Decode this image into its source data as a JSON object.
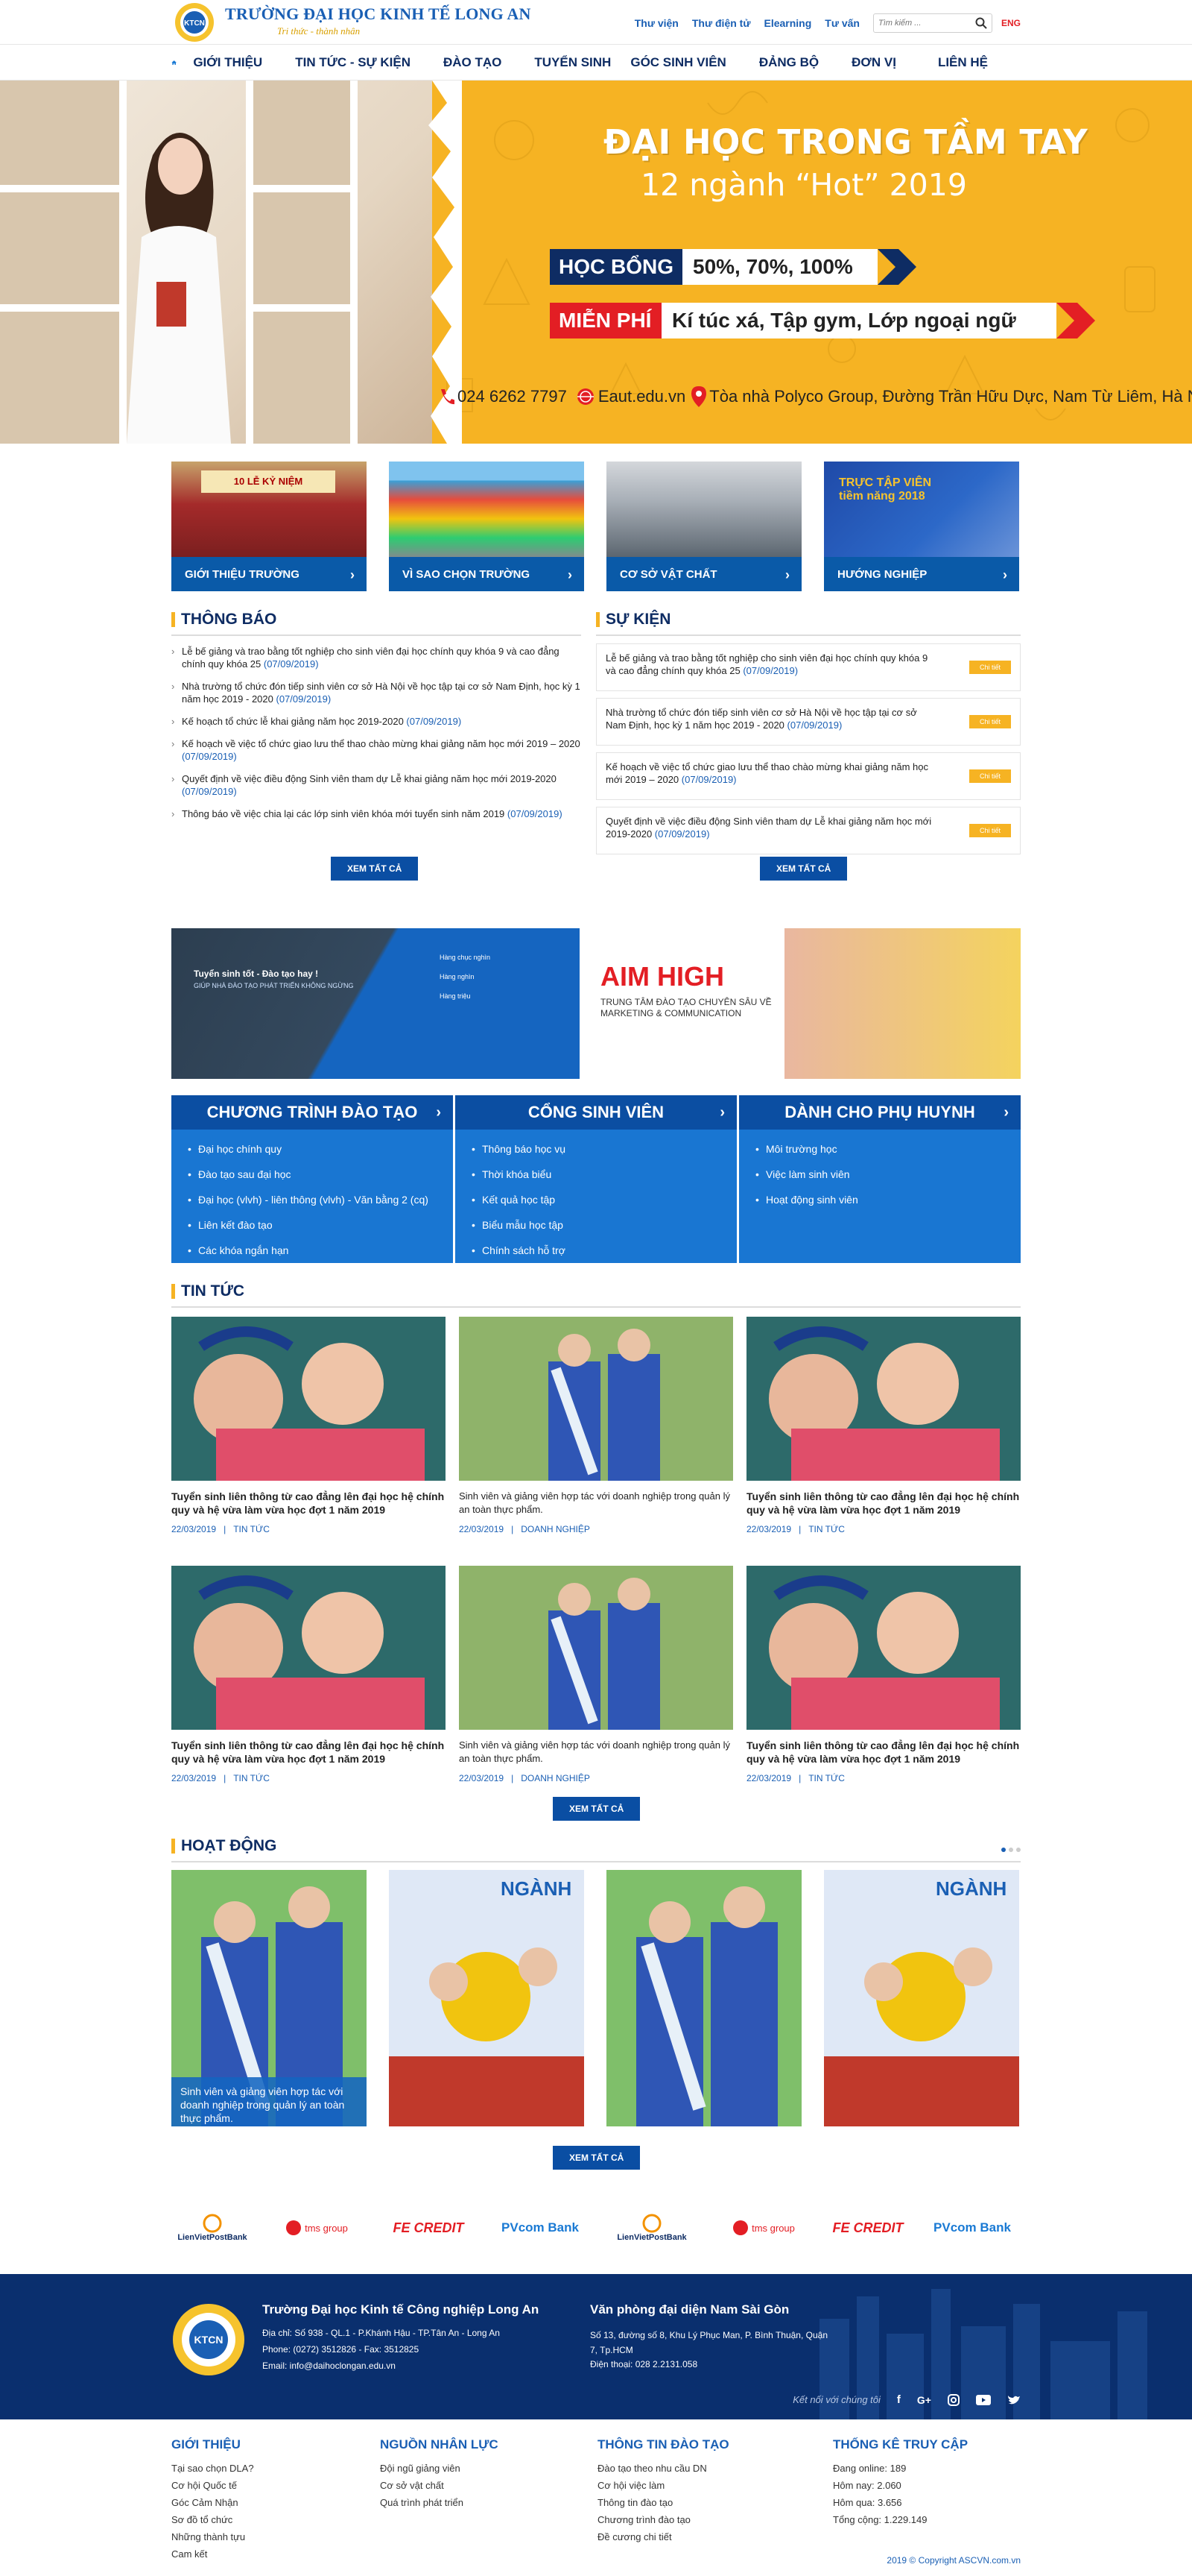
{
  "header": {
    "logo_text": "KTCN",
    "brand_title": "Trường Đại Học Kinh Tế Long An",
    "brand_slogan": "Tri thức - thành nhân",
    "top_links": [
      "Thư viện",
      "Thư điện tử",
      "Elearning",
      "Tư vấn"
    ],
    "search_placeholder": "Tìm kiếm ...",
    "lang": "ENG"
  },
  "nav": {
    "items": [
      "GIỚI THIỆU",
      "TIN TỨC - SỰ KIỆN",
      "ĐÀO TẠO",
      "TUYỂN SINH",
      "GÓC SINH VIÊN",
      "ĐẢNG BỘ",
      "ĐƠN VỊ",
      "LIÊN HỆ"
    ]
  },
  "hero": {
    "title": "ĐẠI HỌC TRONG TẦM TAY",
    "subtitle": "12 ngành “Hot” 2019",
    "scholarship_label": "HỌC BỔNG",
    "scholarship_value": "50%, 70%, 100%",
    "free_label": "MIỄN PHÍ",
    "free_value": "Kí túc xá, Tập gym, Lớp ngoại ngữ",
    "phone": "024 6262 7797",
    "web": "Eaut.edu.vn",
    "address": "Tòa nhà Polyco Group, Đường Trần Hữu Dực, Nam Từ Liêm, Hà Nội",
    "colors": {
      "yellow": "#f6b323",
      "navy": "#0e2c63",
      "red": "#e31e24"
    }
  },
  "tiles": [
    {
      "label": "GIỚI THIỆU TRƯỜNG",
      "image_sign": "10 LỄ KỶ NIỆM"
    },
    {
      "label": "VÌ SAO CHỌN TRƯỜNG"
    },
    {
      "label": "CƠ SỞ VẬT CHẤT"
    },
    {
      "label": "HƯỚNG NGHIỆP",
      "image_sign": "TRỰC TẬP VIÊN tiềm năng 2018"
    }
  ],
  "thong_bao": {
    "title": "THÔNG BÁO",
    "items": [
      {
        "text": "Lễ bế giảng và trao bằng tốt nghiệp cho sinh viên đại học chính quy khóa 9 và cao đẳng chính quy khóa 25",
        "date": "(07/09/2019)"
      },
      {
        "text": "Nhà trường tổ chức đón tiếp sinh viên cơ sở Hà Nội về học tập tại cơ sở Nam Định, học kỳ 1 năm học 2019 - 2020",
        "date": "(07/09/2019)"
      },
      {
        "text": "Kế hoạch tổ chức lễ khai giảng năm học 2019-2020",
        "date": "(07/09/2019)"
      },
      {
        "text": "Kế hoạch về việc tổ chức giao lưu thể thao chào mừng khai giảng năm học mới 2019 – 2020",
        "date": "(07/09/2019)"
      },
      {
        "text": "Quyết định về việc điều động Sinh viên tham dự Lễ khai giảng năm học mới 2019-2020",
        "date": "(07/09/2019)"
      },
      {
        "text": "Thông báo về việc chia lại các lớp sinh viên khóa mới tuyển sinh năm 2019",
        "date": "(07/09/2019)"
      }
    ],
    "view_all": "XEM TẤT CẢ"
  },
  "su_kien": {
    "title": "SỰ KIỆN",
    "detail_label": "Chi tiết",
    "items": [
      {
        "text": "Lễ bế giảng và trao bằng tốt nghiệp cho sinh viên đại học chính quy khóa 9 và cao đẳng chính quy khóa 25",
        "date": "(07/09/2019)"
      },
      {
        "text": "Nhà trường tổ chức đón tiếp sinh viên cơ sở Hà Nội về học tập tại cơ sở Nam Định, học kỳ 1 năm học 2019 - 2020",
        "date": "(07/09/2019)"
      },
      {
        "text": "Kế hoạch về việc tổ chức giao lưu thể thao chào mừng khai giảng năm học mới 2019 – 2020",
        "date": "(07/09/2019)"
      },
      {
        "text": "Quyết định về việc điều động Sinh viên tham dự Lễ khai giảng năm học mới 2019-2020",
        "date": "(07/09/2019)"
      }
    ],
    "view_all": "XEM TẤT CẢ"
  },
  "banners": {
    "left_title": "Tuyển sinh tốt - Đào tạo hay !",
    "left_sub": "GIÚP NHÀ ĐÀO TẠO PHÁT TRIỂN KHÔNG NGỪNG",
    "left_items": [
      "Hàng chục nghìn",
      "Hàng nghìn",
      "Hàng triệu"
    ],
    "right_title": "AIM HIGH",
    "right_sub": "TRUNG TÂM ĐÀO TẠO CHUYÊN SÂU VỀ MARKETING & COMMUNICATION"
  },
  "programs": [
    {
      "title": "CHƯƠNG TRÌNH ĐÀO TẠO",
      "items": [
        "Đại học chính quy",
        "Đào tạo sau đại học",
        "Đại học (vlvh) - liên thông (vlvh) - Văn bằng 2 (cq)",
        "Liên kết đào tạo",
        "Các khóa ngắn hạn"
      ]
    },
    {
      "title": "CỔNG SINH VIÊN",
      "items": [
        "Thông báo học vụ",
        "Thời khóa biểu",
        "Kết quả học tập",
        "Biểu mẫu học tập",
        "Chính sách hỗ trợ"
      ]
    },
    {
      "title": "DÀNH CHO PHỤ HUYNH",
      "items": [
        "Môi trường học",
        "Việc làm sinh viên",
        "Hoạt động sinh viên"
      ]
    }
  ],
  "tin_tuc": {
    "title": "TIN TỨC",
    "cards": [
      {
        "title": "Tuyển sinh liên thông từ cao đẳng lên đại học hệ chính quy và hệ vừa làm vừa học đợt 1 năm 2019",
        "date": "22/03/2019",
        "cat": "TIN TỨC",
        "img": "a"
      },
      {
        "title": "Sinh viên và giảng viên hợp tác với doanh nghiệp trong quản lý an toàn thực phẩm.",
        "date": "22/03/2019",
        "cat": "DOANH NGHIỆP",
        "img": "b"
      },
      {
        "title": "Tuyển sinh liên thông từ cao đẳng lên đại học hệ chính quy và hệ vừa làm vừa học đợt 1 năm 2019",
        "date": "22/03/2019",
        "cat": "TIN TỨC",
        "img": "a"
      },
      {
        "title": "Tuyển sinh liên thông từ cao đẳng lên đại học hệ chính quy và hệ vừa làm vừa học đợt 1 năm 2019",
        "date": "22/03/2019",
        "cat": "TIN TỨC",
        "img": "a"
      },
      {
        "title": "Sinh viên và giảng viên hợp tác với doanh nghiệp trong quản lý an toàn thực phẩm.",
        "date": "22/03/2019",
        "cat": "DOANH NGHIỆP",
        "img": "b"
      },
      {
        "title": "Tuyển sinh liên thông từ cao đẳng lên đại học hệ chính quy và hệ vừa làm vừa học đợt 1 năm 2019",
        "date": "22/03/2019",
        "cat": "TIN TỨC",
        "img": "a"
      }
    ],
    "view_all": "XEM TẤT CẢ"
  },
  "hoat_dong": {
    "title": "HOẠT ĐỘNG",
    "first_caption": "Sinh viên và giảng viên hợp tác với doanh nghiệp trong quản lý an toàn thực phẩm.",
    "image_sign": "NGÀNH",
    "view_all": "XEM TẤT CẢ"
  },
  "partners": [
    "LienVietPostBank",
    "tms group",
    "FE CREDIT",
    "PVcom Bank",
    "LienVietPostBank",
    "tms group",
    "FE CREDIT",
    "PVcom Bank"
  ],
  "footer": {
    "school_name": "Trường Đại học Kinh tế Công nghiệp Long An",
    "address": "Địa chỉ: Số 938 - QL.1 - P.Khánh Hậu - TP.Tân An - Long An",
    "phone": "Phone: (0272) 3512826 - Fax: 3512825",
    "email": "Email: info@daihoclongan.edu.vn",
    "office_title": "Văn phòng đại diện Nam Sài Gòn",
    "office_address": "Số 13, đường số 8, Khu Lý Phục Man, P. Bình Thuận, Quận 7, Tp.HCM",
    "office_phone": "Điện thoại: 028 2.2131.058",
    "connect": "Kết nối với chúng tôi",
    "cols": [
      {
        "title": "GIỚI THIỆU",
        "items": [
          "Tại sao chọn DLA?",
          "Cơ hội Quốc tế",
          "Góc Cảm Nhận",
          "Sơ đồ tổ chức",
          "Những thành tựu",
          "Cam kết"
        ]
      },
      {
        "title": "NGUỒN NHÂN LỰC",
        "items": [
          "Đội ngũ giảng viên",
          "Cơ sở vật chất",
          "Quá trình phát triển"
        ]
      },
      {
        "title": "THÔNG TIN ĐÀO TẠO",
        "items": [
          "Đào tạo theo nhu cầu DN",
          "Cơ hội việc làm",
          "Thông tin đào tạo",
          "Chương trình đào tạo",
          "Đề cương chi tiết"
        ]
      },
      {
        "title": "THỐNG KÊ TRUY CẬP",
        "items": [
          "Đang online: 189",
          "Hôm nay: 2.060",
          "Hôm qua: 3.656",
          "Tổng cộng: 1.229.149"
        ]
      }
    ],
    "copyright": "2019 © Copyright ASCVN.com.vn"
  }
}
